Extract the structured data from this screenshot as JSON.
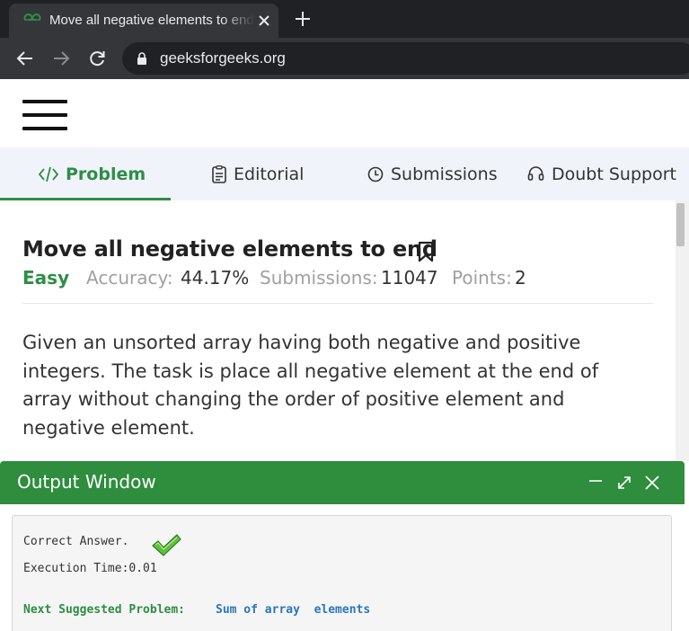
{
  "browser": {
    "tab_title": "Move all negative elements to end | Practice | GeeksforGeeks",
    "url": "geeksforgeeks.org",
    "icons": [
      "gfg-favicon-icon",
      "close-icon",
      "plus-icon",
      "back-arrow-icon",
      "forward-arrow-icon",
      "reload-icon",
      "lock-icon"
    ]
  },
  "header": {
    "menu_icon": "hamburger-menu-icon"
  },
  "problem_tabs": [
    {
      "label": "Problem",
      "icon": "code-icon",
      "active": true
    },
    {
      "label": "Editorial",
      "icon": "document-icon",
      "active": false
    },
    {
      "label": "Submissions",
      "icon": "clock-icon",
      "active": false
    },
    {
      "label": "Doubt Support",
      "icon": "headset-icon",
      "active": false
    }
  ],
  "problem": {
    "title": "Move all negative elements to end",
    "bookmark_icon": "bookmark-icon",
    "difficulty": "Easy",
    "accuracy_label": "Accuracy:",
    "accuracy_value": "44.17%",
    "submissions_label": "Submissions:",
    "submissions_value": "11047",
    "points_label": "Points:",
    "points_value": "2",
    "description_lines": [
      "Given an unsorted array having both negative and positive",
      "integers. The task is place all negative element at the end of",
      "array without changing the order of positive element and",
      "negative element."
    ]
  },
  "output_window": {
    "title": "Output Window",
    "controls": [
      "minimize-icon",
      "expand-icon",
      "close-icon"
    ],
    "result_text": "Correct Answer.",
    "result_icon": "checkmark-icon",
    "execution_time": "Execution Time:0.01",
    "next_label": "Next Suggested Problem:",
    "next_problem": "Sum of array  elements"
  },
  "colors": {
    "accent_green": "#2f8d46",
    "output_header_green": "#2f8d3e",
    "link_blue": "#2a76bb",
    "chrome_dark": "#202124",
    "chrome_toolbar": "#35363a"
  }
}
